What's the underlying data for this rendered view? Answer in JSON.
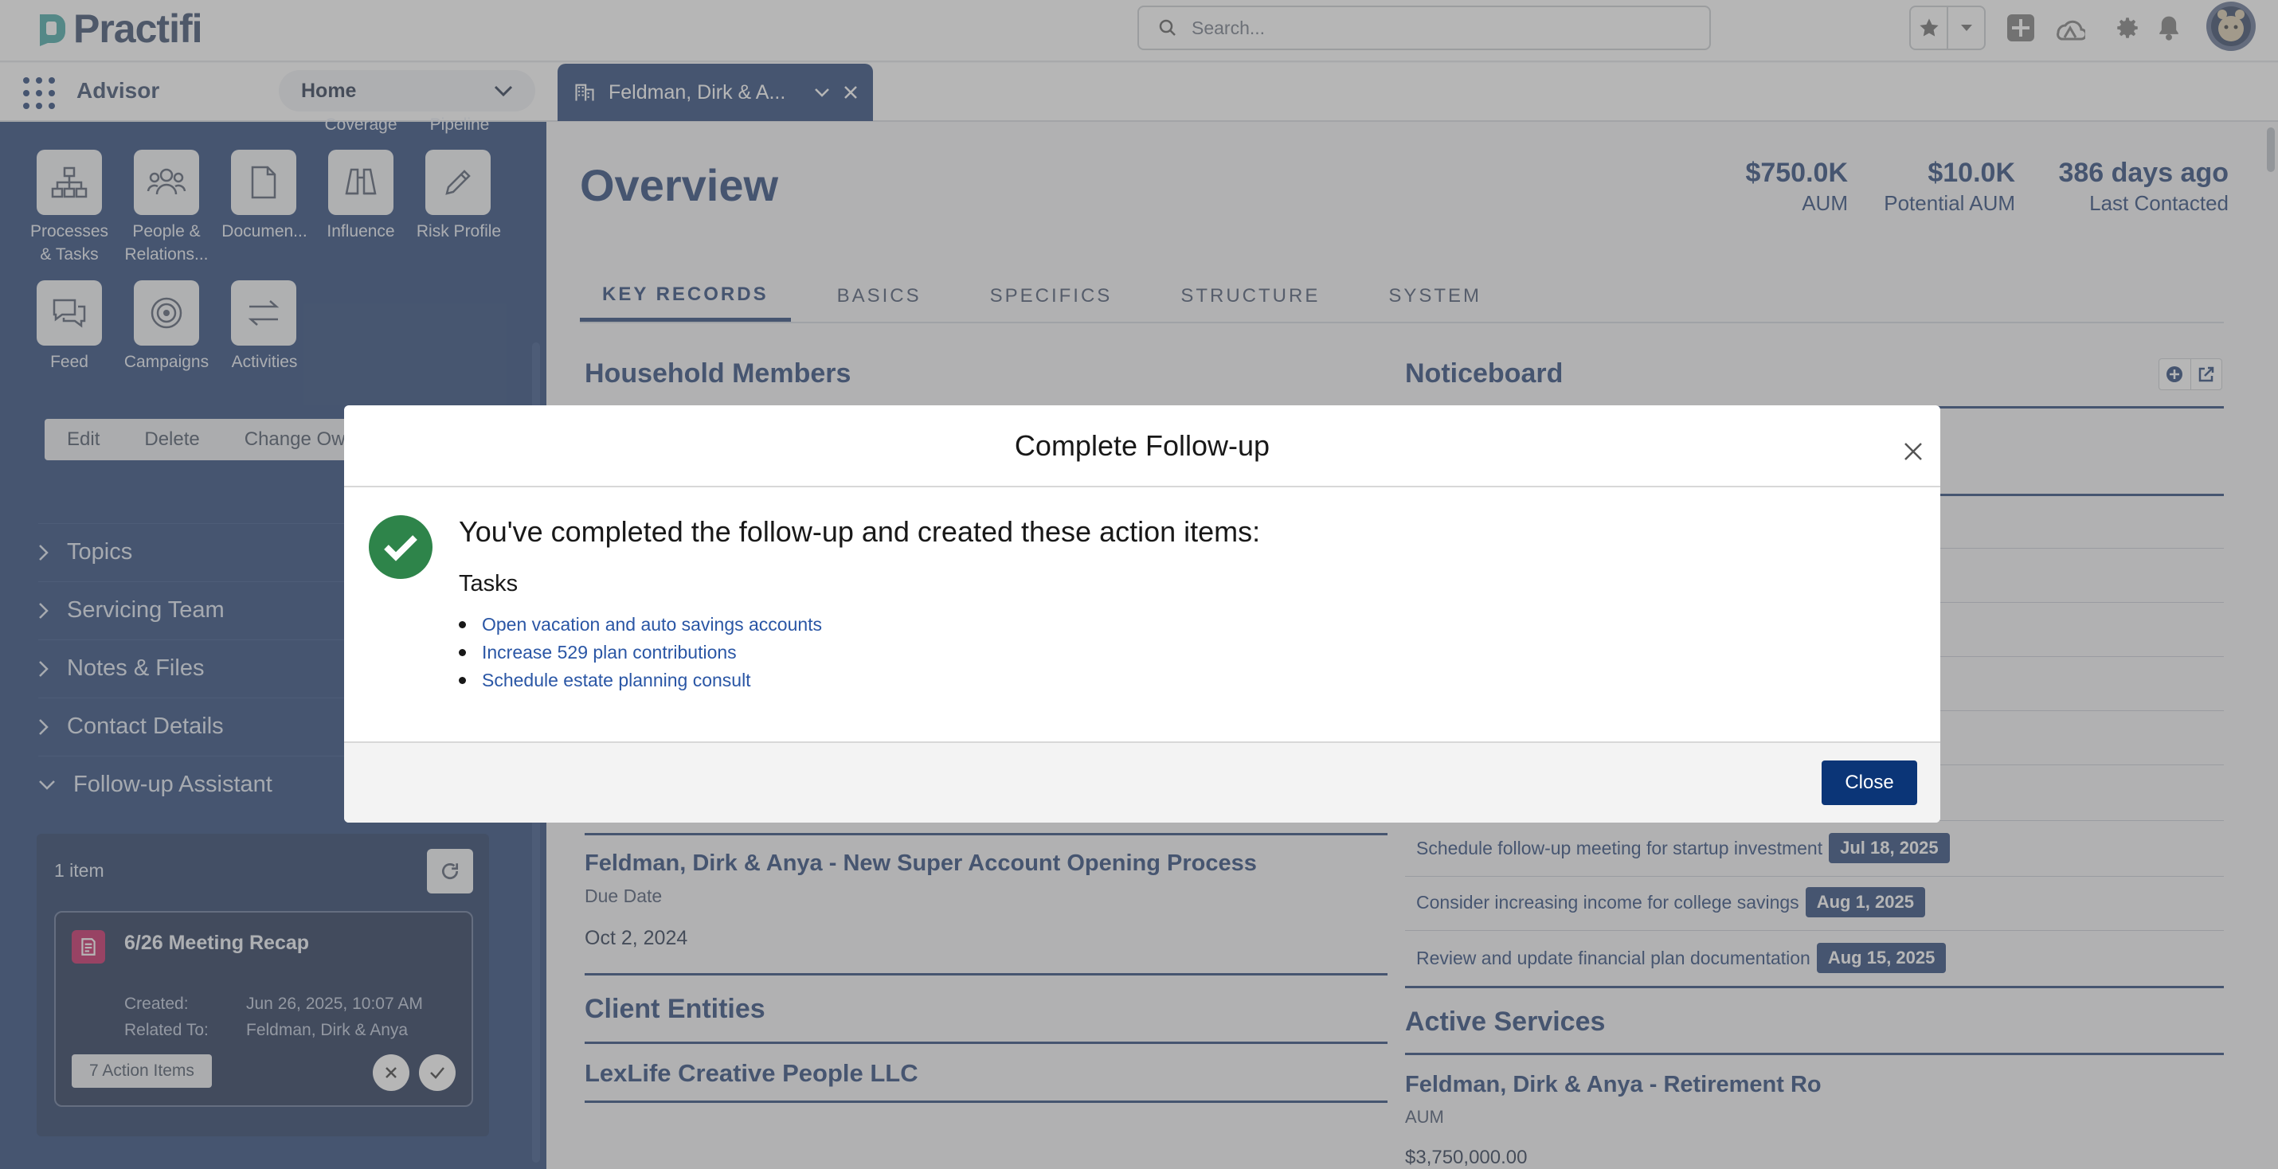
{
  "app": {
    "logo_text": "Practifi",
    "name": "Advisor",
    "nav_selector": "Home",
    "search_placeholder": "Search..."
  },
  "tab": {
    "label": "Feldman, Dirk & A..."
  },
  "sidebar": {
    "partial_labels": [
      "Coverage",
      "Pipeline"
    ],
    "tiles": [
      {
        "label_1": "Processes",
        "label_2": "& Tasks",
        "icon": "hierarchy-icon"
      },
      {
        "label_1": "People &",
        "label_2": "Relations...",
        "icon": "people-icon"
      },
      {
        "label_1": "Documen...",
        "label_2": "",
        "icon": "document-icon"
      },
      {
        "label_1": "Influence",
        "label_2": "",
        "icon": "binoculars-icon"
      },
      {
        "label_1": "Risk Profile",
        "label_2": "",
        "icon": "pencil-icon"
      },
      {
        "label_1": "Feed",
        "label_2": "",
        "icon": "chat-icon"
      },
      {
        "label_1": "Campaigns",
        "label_2": "",
        "icon": "target-icon"
      },
      {
        "label_1": "Activities",
        "label_2": "",
        "icon": "swap-icon"
      }
    ],
    "actions": [
      "Edit",
      "Delete",
      "Change Ow"
    ],
    "sections": [
      "Topics",
      "Servicing Team",
      "Notes & Files",
      "Contact Details",
      "Follow-up Assistant"
    ],
    "followup": {
      "count": "1 item",
      "card_title": "6/26 Meeting Recap",
      "created_label": "Created:",
      "created_value": "Jun 26, 2025, 10:07 AM",
      "related_label": "Related To:",
      "related_value": "Feldman, Dirk & Anya",
      "action_items": "7 Action Items"
    }
  },
  "main": {
    "title": "Overview",
    "stats": [
      {
        "value": "$750.0K",
        "label": "AUM"
      },
      {
        "value": "$10.0K",
        "label": "Potential AUM"
      },
      {
        "value": "386 days ago",
        "label": "Last Contacted"
      }
    ],
    "tabs": [
      "KEY RECORDS",
      "BASICS",
      "SPECIFICS",
      "STRUCTURE",
      "SYSTEM"
    ],
    "household_title": "Household Members",
    "process_title": "Feldman, Dirk & Anya - New Super Account Opening Process",
    "due_label": "Due Date",
    "due_value": "Oct 2, 2024",
    "entities_title": "Client Entities",
    "entity_name": "LexLife Creative People LLC",
    "noticeboard_title": "Noticeboard",
    "notices": [
      {
        "text": "Schedule follow-up meeting for startup investment",
        "date": "Jul 18, 2025"
      },
      {
        "text": "Consider increasing income for college savings",
        "date": "Aug 1, 2025"
      },
      {
        "text": "Review and update financial plan documentation",
        "date": "Aug 15, 2025"
      }
    ],
    "services_title": "Active Services",
    "service_name": "Feldman, Dirk & Anya - Retirement Ro",
    "service_aum_label": "AUM",
    "service_aum_value": "$3,750,000.00"
  },
  "modal": {
    "title": "Complete Follow-up",
    "heading": "You've completed the follow-up and created these action items:",
    "subheading": "Tasks",
    "tasks": [
      "Open vacation and auto savings accounts",
      "Increase 529 plan contributions",
      "Schedule estate planning consult"
    ],
    "close_label": "Close"
  },
  "colors": {
    "brand_navy": "#1f3d73",
    "success_green": "#2e844a",
    "link_blue": "#2a56a5",
    "button_navy": "#0b3577"
  }
}
